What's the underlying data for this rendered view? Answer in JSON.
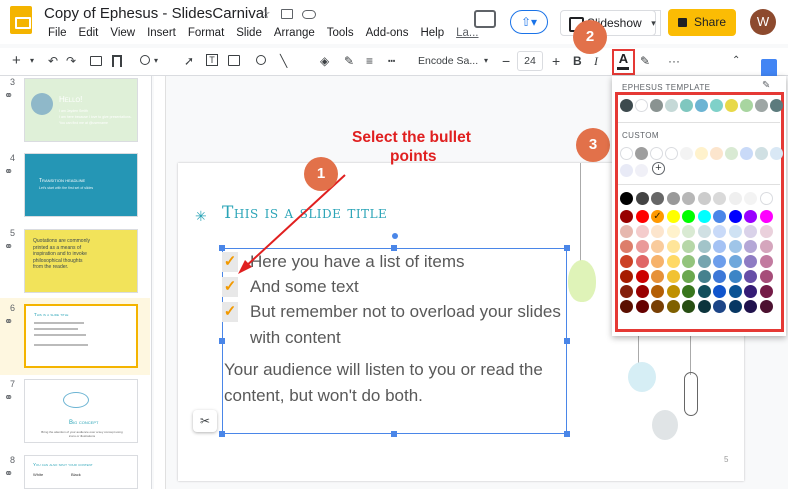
{
  "header": {
    "doc_title": "Copy of Ephesus - SlidesCarnival",
    "menus": [
      "File",
      "Edit",
      "View",
      "Insert",
      "Format",
      "Slide",
      "Arrange",
      "Tools",
      "Add-ons",
      "Help",
      "La..."
    ],
    "slideshow_label": "Slideshow",
    "share_label": "Share",
    "avatar_initial": "W"
  },
  "toolbar": {
    "font_name": "Encode Sa...",
    "font_size": "24",
    "text_color_glyph": "A"
  },
  "filmstrip": {
    "slide_numbers": [
      "3",
      "4",
      "5",
      "6",
      "7",
      "8"
    ],
    "thumb3": {
      "title": "Hello!",
      "lines": [
        "I am Jayden Smith",
        "I am here because I love to give presentations.",
        "You can find me at @username"
      ]
    },
    "thumb4": {
      "title": "Transition headline",
      "subtitle": "Let's start with the first set of slides"
    },
    "thumb5": {
      "text": "Quotations are commonly printed as a means of inspiration and to invoke philosophical thoughts from the reader."
    },
    "thumb6": {
      "title": "This is a slide title"
    },
    "thumb7": {
      "title": "Big concept",
      "subtitle": "Bring the attention of your audience over a key concept using icons or illustrations"
    },
    "thumb8": {
      "title": "You can also split your content",
      "cols": [
        "White",
        "Black"
      ]
    }
  },
  "slide": {
    "title": "This is a slide title",
    "bullets": [
      "Here you have a list of items",
      "And some text",
      "But remember not to overload your slides",
      "with content"
    ],
    "paragraph": [
      "Your audience will listen to you or read the",
      "content, but won't do both."
    ],
    "page_number": "5"
  },
  "annotations": {
    "instruction_lines": [
      "Select the bullet",
      "points"
    ],
    "step1": "1",
    "step2": "2",
    "step3": "3"
  },
  "color_picker": {
    "template_label": "EPHESUS TEMPLATE",
    "custom_label": "CUSTOM",
    "custom_add": "+",
    "template_colors": [
      "#3d4a4e",
      "#ffffff",
      "#8a9391",
      "#c5d9d7",
      "#7fc7bf",
      "#6cb4d3",
      "#7fd1c9",
      "#e8d94a",
      "#a8d5a0",
      "#9ea7a5",
      "#5c7b7d"
    ],
    "custom_colors": [
      "#ffffff",
      "#9e9e9e",
      "#ffffff",
      "#ffffff",
      "#f3f3f3",
      "#fff2cc",
      "#fce5cd",
      "#d9ead3",
      "#c9daf8",
      "#d0e0e3",
      "#d9e8f5",
      "#e8eaf6",
      "#f0f0f7"
    ],
    "grid": [
      [
        "#000000",
        "#434343",
        "#666666",
        "#999999",
        "#b7b7b7",
        "#cccccc",
        "#d9d9d9",
        "#efefef",
        "#f3f3f3",
        "#ffffff"
      ],
      [
        "#980000",
        "#ff0000",
        "#ff9900",
        "#ffff00",
        "#00ff00",
        "#00ffff",
        "#4a86e8",
        "#0000ff",
        "#9900ff",
        "#ff00ff"
      ],
      [
        "#e6b8af",
        "#f4cccc",
        "#fce5cd",
        "#fff2cc",
        "#d9ead3",
        "#d0e0e3",
        "#c9daf8",
        "#cfe2f3",
        "#d9d2e9",
        "#ead1dc"
      ],
      [
        "#dd7e6b",
        "#ea9999",
        "#f9cb9c",
        "#ffe599",
        "#b6d7a8",
        "#a2c4c9",
        "#a4c2f4",
        "#9fc5e8",
        "#b4a7d6",
        "#d5a6bd"
      ],
      [
        "#cc4125",
        "#e06666",
        "#f6b26b",
        "#ffd966",
        "#93c47d",
        "#76a5af",
        "#6d9eeb",
        "#6fa8dc",
        "#8e7cc3",
        "#c27ba0"
      ],
      [
        "#a61c00",
        "#cc0000",
        "#e69138",
        "#f1c232",
        "#6aa84f",
        "#45818e",
        "#3c78d8",
        "#3d85c6",
        "#674ea7",
        "#a64d79"
      ],
      [
        "#85200c",
        "#990000",
        "#b45f06",
        "#bf9000",
        "#38761d",
        "#134f5c",
        "#1155cc",
        "#0b5394",
        "#351c75",
        "#741b47"
      ],
      [
        "#5b0f00",
        "#660000",
        "#783f04",
        "#7f6000",
        "#274e13",
        "#0c343d",
        "#1c4587",
        "#073763",
        "#20124d",
        "#4c1130"
      ]
    ]
  }
}
